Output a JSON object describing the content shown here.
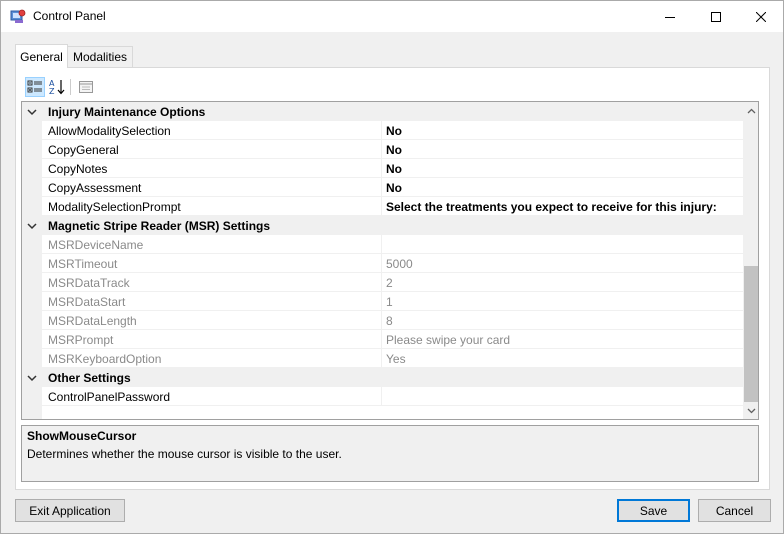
{
  "window": {
    "title": "Control Panel",
    "icon": "control-panel-app-icon"
  },
  "tabs": [
    {
      "label": "General",
      "selected": true
    },
    {
      "label": "Modalities",
      "selected": false
    }
  ],
  "toolbar": {
    "categorized_icon": "categorized-view-icon",
    "alphabetical_icon": "alphabetical-sort-icon",
    "property_pages_icon": "property-pages-icon"
  },
  "grid": {
    "categories": [
      {
        "label": "Injury Maintenance Options",
        "expanded": true,
        "properties": [
          {
            "name": "AllowModalitySelection",
            "value": "No",
            "bold": true,
            "enabled": true
          },
          {
            "name": "CopyGeneral",
            "value": "No",
            "bold": true,
            "enabled": true
          },
          {
            "name": "CopyNotes",
            "value": "No",
            "bold": true,
            "enabled": true
          },
          {
            "name": "CopyAssessment",
            "value": "No",
            "bold": true,
            "enabled": true
          },
          {
            "name": "ModalitySelectionPrompt",
            "value": "Select the treatments you expect to receive for this injury:",
            "bold": true,
            "enabled": true
          }
        ]
      },
      {
        "label": "Magnetic Stripe Reader (MSR) Settings",
        "expanded": true,
        "properties": [
          {
            "name": "MSRDeviceName",
            "value": "",
            "bold": false,
            "enabled": false
          },
          {
            "name": "MSRTimeout",
            "value": "5000",
            "bold": false,
            "enabled": false
          },
          {
            "name": "MSRDataTrack",
            "value": "2",
            "bold": false,
            "enabled": false
          },
          {
            "name": "MSRDataStart",
            "value": "1",
            "bold": false,
            "enabled": false
          },
          {
            "name": "MSRDataLength",
            "value": "8",
            "bold": false,
            "enabled": false
          },
          {
            "name": "MSRPrompt",
            "value": "Please swipe your card",
            "bold": false,
            "enabled": false
          },
          {
            "name": "MSRKeyboardOption",
            "value": "Yes",
            "bold": false,
            "enabled": false
          }
        ]
      },
      {
        "label": "Other Settings",
        "expanded": true,
        "properties": [
          {
            "name": "ControlPanelPassword",
            "value": "",
            "bold": false,
            "enabled": true
          }
        ]
      }
    ]
  },
  "help": {
    "title": "ShowMouseCursor",
    "description": "Determines whether the mouse cursor is visible to the user."
  },
  "buttons": {
    "exit": "Exit Application",
    "save": "Save",
    "cancel": "Cancel"
  },
  "colors": {
    "selected_toolbar_bg": "#cce8ff",
    "default_button_border": "#0078d7",
    "disabled_text": "#8a8a8a"
  }
}
